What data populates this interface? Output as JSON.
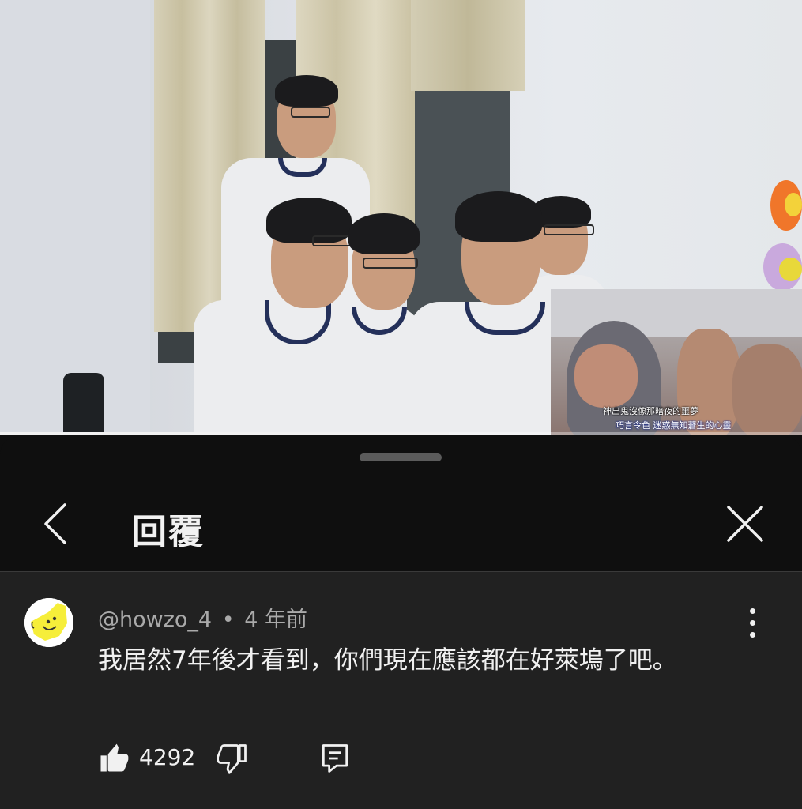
{
  "video": {
    "subtitle_line1": "神出鬼沒像那暗夜的噩夢",
    "subtitle_line2": "巧言令色 迷惑無知蒼生的心靈",
    "progress_fraction": 0.56
  },
  "sheet": {
    "title": "回覆"
  },
  "comment": {
    "author": "@howzo_4",
    "separator": "•",
    "time": "4 年前",
    "text": "我居然7年後才看到，你們現在應該都在好萊塢了吧。",
    "like_count": "4292"
  },
  "icons": {
    "back": "chevron-left-icon",
    "close": "close-icon",
    "more": "more-vertical-icon",
    "like": "thumbs-up-icon",
    "dislike": "thumbs-down-icon",
    "reply": "reply-icon"
  },
  "colors": {
    "background": "#0f0f0f",
    "comment_panel": "#212121",
    "text_primary": "#f1f1f1",
    "text_secondary": "#aaaaaa"
  }
}
